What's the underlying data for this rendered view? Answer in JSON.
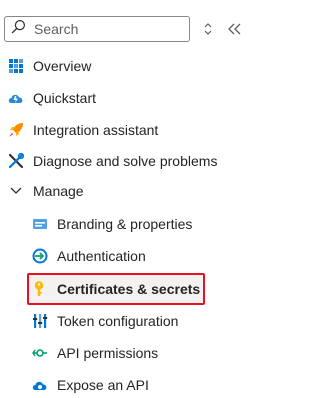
{
  "search": {
    "placeholder": "Search"
  },
  "nav": {
    "overview": "Overview",
    "quickstart": "Quickstart",
    "integration": "Integration assistant",
    "diagnose": "Diagnose and solve problems",
    "manage": "Manage",
    "branding": "Branding & properties",
    "authentication": "Authentication",
    "certificates": "Certificates & secrets",
    "token": "Token configuration",
    "api_permissions": "API permissions",
    "expose_api": "Expose an API"
  },
  "colors": {
    "selection_border": "#e81123",
    "accent_blue": "#0078d4"
  }
}
